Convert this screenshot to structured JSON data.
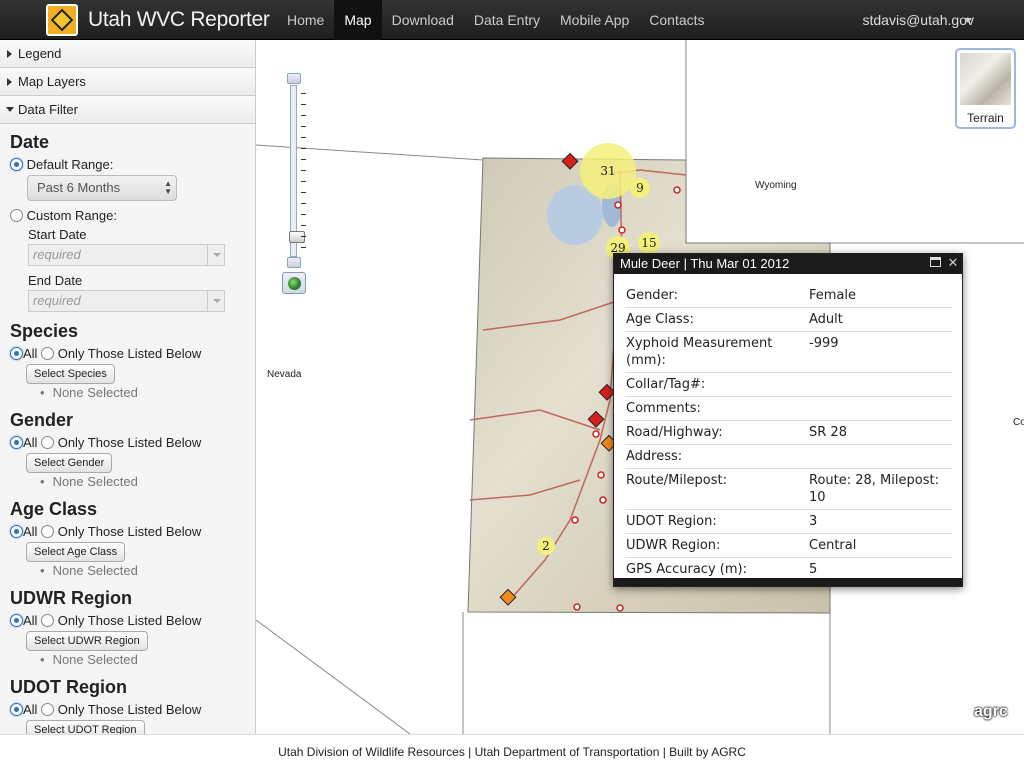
{
  "app": {
    "title": "Utah WVC Reporter"
  },
  "nav": {
    "items": [
      {
        "label": "Home"
      },
      {
        "label": "Map"
      },
      {
        "label": "Download"
      },
      {
        "label": "Data Entry"
      },
      {
        "label": "Mobile App"
      },
      {
        "label": "Contacts"
      }
    ],
    "active": "Map",
    "user": "stdavis@utah.gov"
  },
  "sidebar": {
    "accordions": {
      "legend": "Legend",
      "layers": "Map Layers",
      "filter": "Data Filter"
    },
    "date": {
      "title": "Date",
      "default_label": "Default Range:",
      "default_value": "Past 6 Months",
      "custom_label": "Custom Range:",
      "start_label": "Start Date",
      "start_placeholder": "required",
      "end_label": "End Date",
      "end_placeholder": "required"
    },
    "sections": [
      {
        "title": "Species",
        "all": "All",
        "only": "Only Those Listed Below",
        "button": "Select Species",
        "none": "None Selected"
      },
      {
        "title": "Gender",
        "all": "All",
        "only": "Only Those Listed Below",
        "button": "Select Gender",
        "none": "None Selected"
      },
      {
        "title": "Age Class",
        "all": "All",
        "only": "Only Those Listed Below",
        "button": "Select Age Class",
        "none": "None Selected"
      },
      {
        "title": "UDWR Region",
        "all": "All",
        "only": "Only Those Listed Below",
        "button": "Select UDWR Region",
        "none": "None Selected"
      },
      {
        "title": "UDOT Region",
        "all": "All",
        "only": "Only Those Listed Below",
        "button": "Select UDOT Region",
        "none": ""
      }
    ]
  },
  "map": {
    "labels": {
      "nevada": "Nevada",
      "wyoming": "Wyoming",
      "colorado": "Co"
    },
    "clusters": [
      "31",
      "9",
      "29",
      "15",
      "2"
    ],
    "basemap_label": "Terrain",
    "watermark": "agrc",
    "colors": {
      "cluster": "#f4f07a",
      "red_marker": "#d81e1e",
      "orange_marker": "#f08a1c"
    }
  },
  "popup": {
    "title": "Mule Deer | Thu Mar 01 2012",
    "attributes": [
      {
        "key": "Gender:",
        "value": "Female"
      },
      {
        "key": "Age Class:",
        "value": "Adult"
      },
      {
        "key": "Xyphoid Measurement (mm):",
        "value": "-999"
      },
      {
        "key": "Collar/Tag#:",
        "value": ""
      },
      {
        "key": "Comments:",
        "value": ""
      },
      {
        "key": "Road/Highway:",
        "value": "SR 28"
      },
      {
        "key": "Address:",
        "value": ""
      },
      {
        "key": "Route/Milepost:",
        "value": "Route: 28, Milepost: 10"
      },
      {
        "key": "UDOT Region:",
        "value": "3"
      },
      {
        "key": "UDWR Region:",
        "value": "Central"
      },
      {
        "key": "GPS Accuracy (m):",
        "value": "5"
      }
    ]
  },
  "footer": {
    "text": "Utah Division of Wildlife Resources | Utah Department of Transportation | Built by AGRC"
  }
}
